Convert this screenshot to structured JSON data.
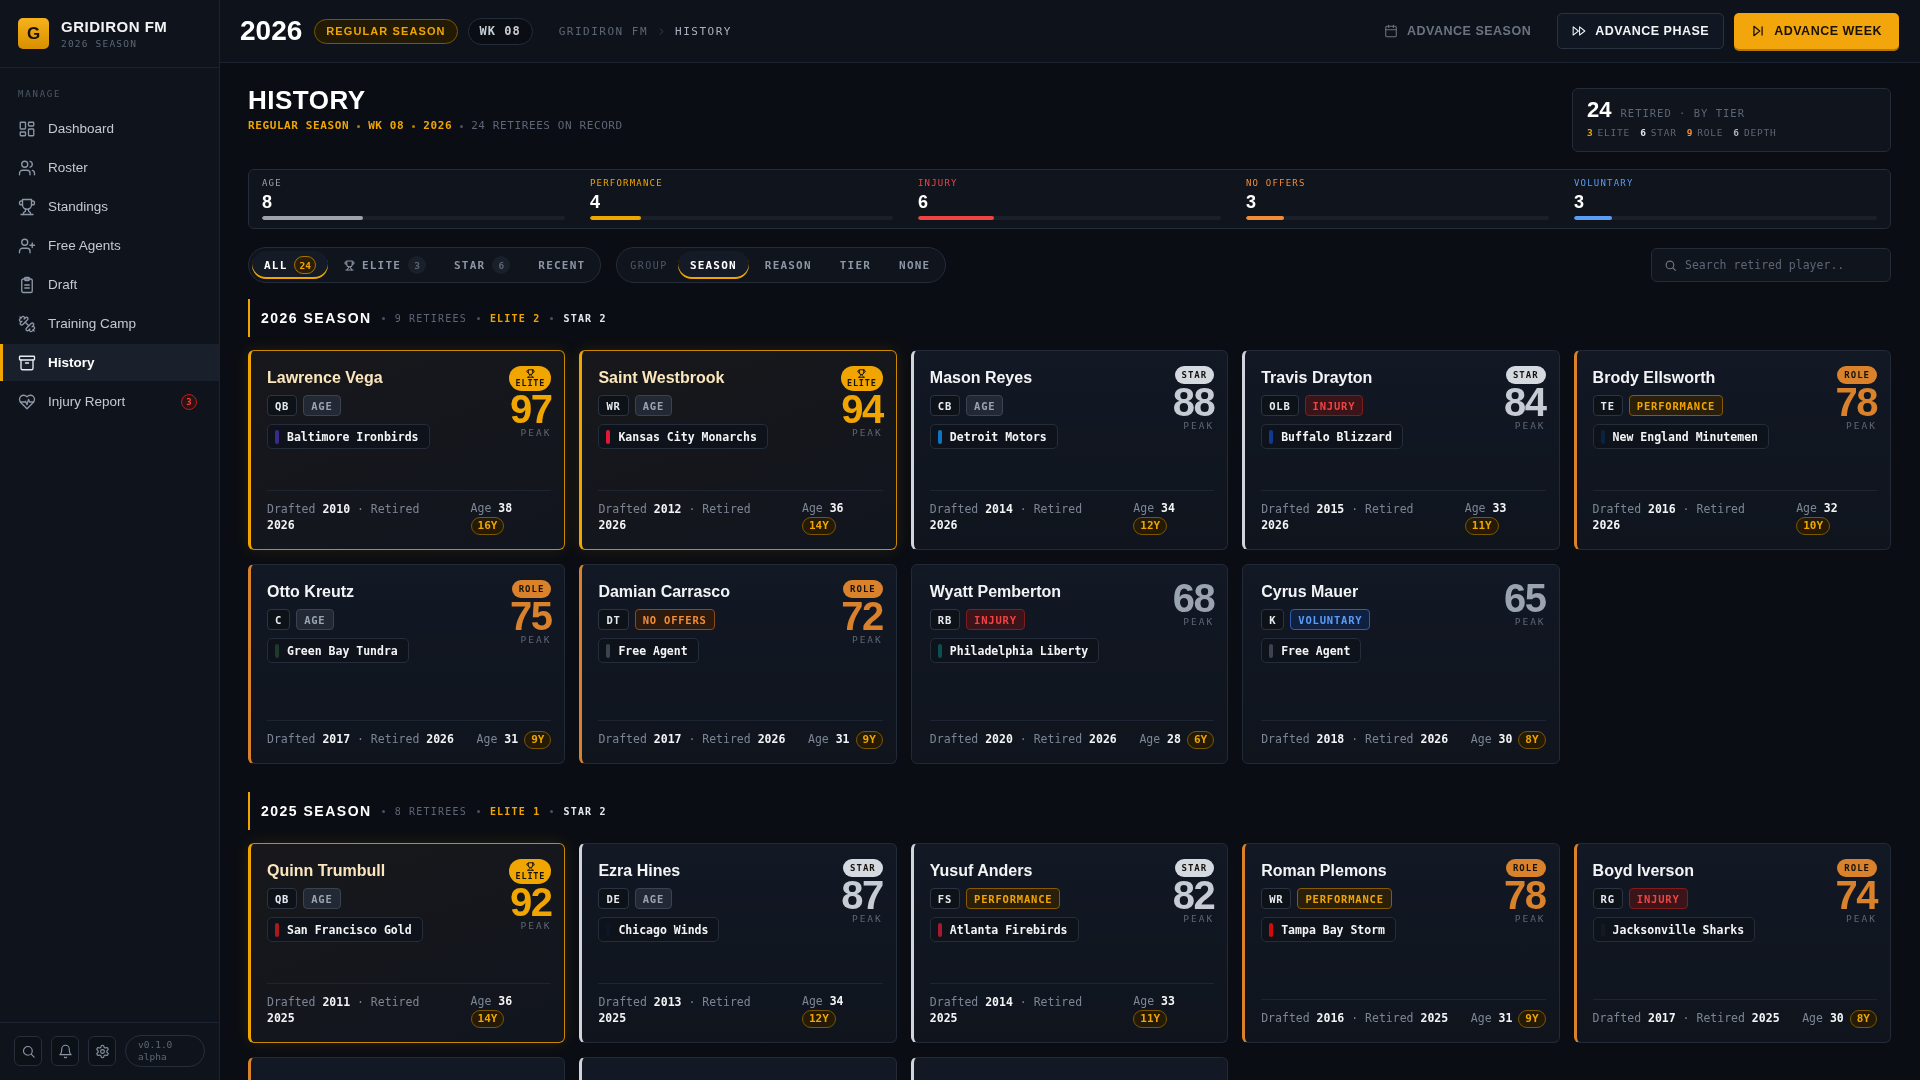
{
  "sidebar": {
    "logo": "G",
    "title": "GRIDIRON FM",
    "subtitle": "2026 SEASON",
    "section": "MANAGE",
    "items": [
      {
        "label": "Dashboard",
        "selected": false
      },
      {
        "label": "Roster",
        "selected": false
      },
      {
        "label": "Standings",
        "selected": false
      },
      {
        "label": "Free Agents",
        "selected": false
      },
      {
        "label": "Draft",
        "selected": false
      },
      {
        "label": "Training Camp",
        "selected": false
      },
      {
        "label": "History",
        "selected": true
      },
      {
        "label": "Injury Report",
        "selected": false,
        "badge": "3"
      }
    ],
    "version": "v0.1.0 alpha"
  },
  "header": {
    "year": "2026",
    "phase": "REGULAR SEASON",
    "week": "WK 08",
    "breadcrumb": [
      "GRIDIRON FM",
      "HISTORY"
    ],
    "actions": [
      {
        "label": "ADVANCE SEASON",
        "kind": "link"
      },
      {
        "label": "ADVANCE PHASE",
        "kind": "outline"
      },
      {
        "label": "ADVANCE WEEK",
        "kind": "primary"
      }
    ]
  },
  "page": {
    "title": "HISTORY",
    "context": [
      "REGULAR SEASON",
      "WK 08",
      "2026"
    ],
    "note": "24 RETIREES ON RECORD",
    "summary": {
      "total": "24",
      "label": "RETIRED · BY TIER",
      "tiers": [
        {
          "count": "3",
          "label": "ELITE",
          "color": "#f0a500"
        },
        {
          "count": "6",
          "label": "STAR",
          "color": "#e5e7eb"
        },
        {
          "count": "9",
          "label": "ROLE",
          "color": "#f28c38"
        },
        {
          "count": "6",
          "label": "DEPTH",
          "color": "#a9b4c6"
        }
      ]
    }
  },
  "reasons": [
    {
      "label": "AGE",
      "value": "8",
      "level": 0.333,
      "color": "#9ca3af"
    },
    {
      "label": "PERFORMANCE",
      "value": "4",
      "level": 0.167,
      "color": "#f0a500"
    },
    {
      "label": "INJURY",
      "value": "6",
      "level": 0.25,
      "color": "#ef4444"
    },
    {
      "label": "NO OFFERS",
      "value": "3",
      "level": 0.125,
      "color": "#f28c38"
    },
    {
      "label": "VOLUNTARY",
      "value": "3",
      "level": 0.125,
      "color": "#5b9cf5"
    }
  ],
  "filters": {
    "tiers": [
      {
        "label": "ALL",
        "count": "24",
        "kind": "all",
        "selected": true
      },
      {
        "label": "ELITE",
        "count": "3",
        "kind": "elite",
        "selected": false
      },
      {
        "label": "STAR",
        "count": "6",
        "kind": "star",
        "selected": false
      },
      {
        "label": "RECENT",
        "kind": "recent",
        "selected": false
      }
    ],
    "group_label": "GROUP",
    "groups": [
      {
        "label": "SEASON",
        "selected": true
      },
      {
        "label": "REASON",
        "selected": false
      },
      {
        "label": "TIER",
        "selected": false
      },
      {
        "label": "NONE",
        "selected": false
      }
    ],
    "search": {
      "placeholder": "Search retired player.."
    }
  },
  "sections": [
    {
      "title": "2026 SEASON",
      "retirees": "9 RETIREES",
      "elite": "ELITE 2",
      "star": "STAR 2",
      "players": [
        {
          "name": "Lawrence Vega",
          "kind": "elite",
          "badge": "ELITE",
          "peak": "97",
          "peak_label": "PEAK",
          "position": "QB",
          "reason": {
            "label": "AGE",
            "kind": "age"
          },
          "team": {
            "name": "Baltimore Ironbirds",
            "color": "#3a2a8c"
          },
          "career": "Drafted **2010** · Retired **2026**",
          "age": "Age **38**",
          "years": "16Y"
        },
        {
          "name": "Saint Westbrook",
          "kind": "elite",
          "badge": "ELITE",
          "peak": "94",
          "peak_label": "PEAK",
          "position": "WR",
          "reason": {
            "label": "AGE",
            "kind": "age"
          },
          "team": {
            "name": "Kansas City Monarchs",
            "color": "#e31837"
          },
          "career": "Drafted **2012** · Retired **2026**",
          "age": "Age **36**",
          "years": "14Y"
        },
        {
          "name": "Mason Reyes",
          "kind": "star",
          "badge": "STAR",
          "peak": "88",
          "peak_label": "PEAK",
          "position": "CB",
          "reason": {
            "label": "AGE",
            "kind": "age"
          },
          "team": {
            "name": "Detroit Motors",
            "color": "#0b76c5"
          },
          "career": "Drafted **2014** · Retired **2026**",
          "age": "Age **34**",
          "years": "12Y"
        },
        {
          "name": "Travis Drayton",
          "kind": "star",
          "badge": "STAR",
          "peak": "84",
          "peak_label": "PEAK",
          "position": "OLB",
          "reason": {
            "label": "INJURY",
            "kind": "injury"
          },
          "team": {
            "name": "Buffalo Blizzard",
            "color": "#12398f"
          },
          "career": "Drafted **2015** · Retired **2026**",
          "age": "Age **33**",
          "years": "11Y"
        },
        {
          "name": "Brody Ellsworth",
          "kind": "role",
          "badge": "ROLE",
          "peak": "78",
          "peak_label": "PEAK",
          "position": "TE",
          "reason": {
            "label": "PERFORMANCE",
            "kind": "performance"
          },
          "team": {
            "name": "New England Minutemen",
            "color": "#0c2340"
          },
          "career": "Drafted **2016** · Retired **2026**",
          "age": "Age **32**",
          "years": "10Y"
        },
        {
          "name": "Otto Kreutz",
          "kind": "role",
          "badge": "ROLE",
          "peak": "75",
          "peak_label": "PEAK",
          "position": "C",
          "reason": {
            "label": "AGE",
            "kind": "age"
          },
          "team": {
            "name": "Green Bay Tundra",
            "color": "#1e3a2a"
          },
          "career": "Drafted **2017** · Retired **2026**",
          "age": "Age **31**",
          "years": "9Y"
        },
        {
          "name": "Damian Carrasco",
          "kind": "role",
          "badge": "ROLE",
          "peak": "72",
          "peak_label": "PEAK",
          "position": "DT",
          "reason": {
            "label": "NO OFFERS",
            "kind": "no_offers"
          },
          "team": {
            "name": "Free Agent",
            "color": "#3b4350"
          },
          "career": "Drafted **2017** · Retired **2026**",
          "age": "Age **31**",
          "years": "9Y"
        },
        {
          "name": "Wyatt Pemberton",
          "kind": "depth",
          "peak": "68",
          "peak_label": "PEAK",
          "position": "RB",
          "reason": {
            "label": "INJURY",
            "kind": "injury"
          },
          "team": {
            "name": "Philadelphia Liberty",
            "color": "#0b4f52"
          },
          "career": "Drafted **2020** · Retired **2026**",
          "age": "Age **28**",
          "years": "6Y"
        },
        {
          "name": "Cyrus Mauer",
          "kind": "depth",
          "peak": "65",
          "peak_label": "PEAK",
          "position": "K",
          "reason": {
            "label": "VOLUNTARY",
            "kind": "voluntary"
          },
          "team": {
            "name": "Free Agent",
            "color": "#3b4350"
          },
          "career": "Drafted **2018** · Retired **2026**",
          "age": "Age **30**",
          "years": "8Y"
        }
      ]
    },
    {
      "title": "2025 SEASON",
      "retirees": "8 RETIREES",
      "elite": "ELITE 1",
      "star": "STAR 2",
      "players": [
        {
          "name": "Quinn Trumbull",
          "kind": "elite",
          "badge": "ELITE",
          "peak": "92",
          "peak_label": "PEAK",
          "position": "QB",
          "reason": {
            "label": "AGE",
            "kind": "age"
          },
          "team": {
            "name": "San Francisco Gold",
            "color": "#aa1a1a"
          },
          "career": "Drafted **2011** · Retired **2025**",
          "age": "Age **36**",
          "years": "14Y"
        },
        {
          "name": "Ezra Hines",
          "kind": "star",
          "badge": "STAR",
          "peak": "87",
          "peak_label": "PEAK",
          "position": "DE",
          "reason": {
            "label": "AGE",
            "kind": "age"
          },
          "team": {
            "name": "Chicago Winds",
            "color": "#0b162a"
          },
          "career": "Drafted **2013** · Retired **2025**",
          "age": "Age **34**",
          "years": "12Y"
        },
        {
          "name": "Yusuf Anders",
          "kind": "star",
          "badge": "STAR",
          "peak": "82",
          "peak_label": "PEAK",
          "position": "FS",
          "reason": {
            "label": "PERFORMANCE",
            "kind": "performance"
          },
          "team": {
            "name": "Atlanta Firebirds",
            "color": "#a71930"
          },
          "career": "Drafted **2014** · Retired **2025**",
          "age": "Age **33**",
          "years": "11Y"
        },
        {
          "name": "Roman Plemons",
          "kind": "role",
          "badge": "ROLE",
          "peak": "78",
          "peak_label": "PEAK",
          "position": "WR",
          "reason": {
            "label": "PERFORMANCE",
            "kind": "performance"
          },
          "team": {
            "name": "Tampa Bay Storm",
            "color": "#d50a0a"
          },
          "career": "Drafted **2016** · Retired **2025**",
          "age": "Age **31**",
          "years": "9Y"
        },
        {
          "name": "Boyd Iverson",
          "kind": "role",
          "badge": "ROLE",
          "peak": "74",
          "peak_label": "PEAK",
          "position": "RG",
          "reason": {
            "label": "INJURY",
            "kind": "injury"
          },
          "team": {
            "name": "Jacksonville Sharks",
            "color": "#141a24"
          },
          "career": "Drafted **2017** · Retired **2025**",
          "age": "Age **30**",
          "years": "8Y"
        },
        {
          "kind": "role"
        },
        {
          "kind": "star"
        },
        {
          "kind": "star"
        }
      ]
    }
  ]
}
